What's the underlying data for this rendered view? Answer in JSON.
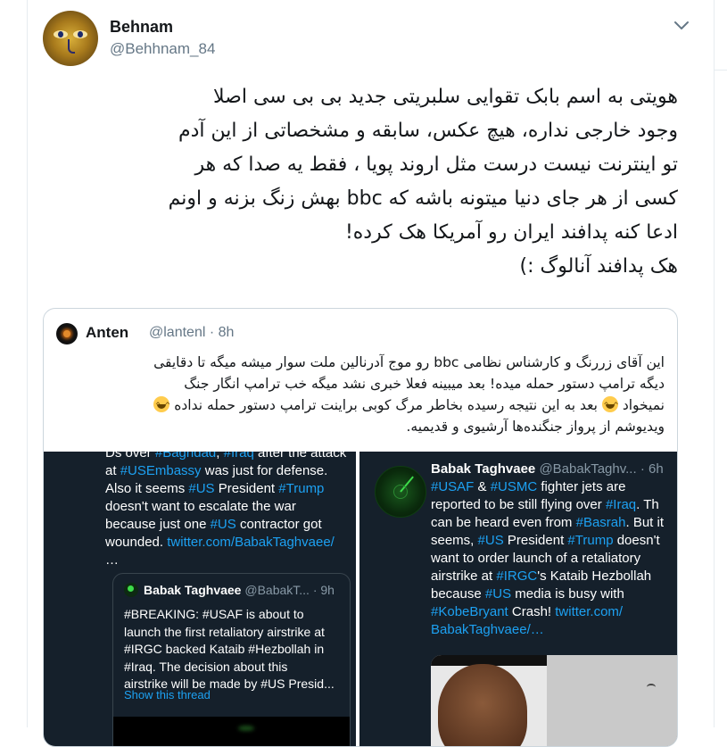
{
  "tweet": {
    "display_name": "Behnam",
    "handle": "@Behhnam_84",
    "text_lines": [
      "هویتی به اسم بابک تقوایی سلبریتی جدید بی بی سی اصلا",
      "وجود خارجی نداره، هیچ عکس، سابقه و مشخصاتی از این آدم",
      "تو اینترنت نیست درست مثل اروند پویا ، فقط یه صدا که هر",
      "کسی از هر جای دنیا میتونه باشه که bbc بهش زنگ بزنه و اونم",
      "ادعا کنه پدافند ایران رو آمریکا هک کرده!",
      "هک پدافند آنالوگ :)"
    ]
  },
  "quoted": {
    "display_name": "Anten",
    "handle": "@lantenl",
    "time": "8h",
    "text_lines": [
      "این آقای زررنگ و کارشناس نظامی bbc رو موج آدرنالین ملت سوار میشه میگه تا دقایقی",
      "دیگه ترامپ دستور حمله میده! بعد میبینه فعلا خبری نشد میگه خب ترامپ انگار جنگ",
      "نمیخواد 😆 بعد به این نتیجه رسیده بخاطر مرگ کوبی براینت ترامپ دستور حمله نداده 😆",
      "ویدیوشم از پرواز جنگنده‌ها آرشیوی و قدیمیه."
    ],
    "text_line3_parts": {
      "before_emoji": "نمیخواد",
      "middle": "بعد به این نتیجه رسیده بخاطر مرگ کوبی براینت ترامپ دستور حمله نداده"
    }
  },
  "media_left": {
    "tweet_lines": [
      [
        "Ds over ",
        "#Baghdad",
        ", ",
        "#Iraq",
        " after the attack"
      ],
      [
        "at ",
        "#USEmbassy",
        " was just for defense."
      ],
      [
        "Also it seems ",
        "#US",
        " President ",
        "#Trump"
      ],
      [
        "doesn't want to escalate the war"
      ],
      [
        "because just one ",
        "#US",
        " contractor got"
      ],
      [
        "wounded. ",
        "twitter.com/BabakTaghvaee/"
      ],
      [
        "…"
      ]
    ],
    "inner": {
      "display_name": "Babak Taghvaee",
      "handle": "@BabakT...",
      "time": "9h",
      "text_lines": [
        "#BREAKING: #USAF is about to",
        "launch the first retaliatory airstrike at",
        "#IRGC backed Kataib #Hezbollah in",
        "#Iraq. The decision about this",
        "airstrike will be made by #US Presid..."
      ],
      "show_thread": "Show this thread"
    }
  },
  "media_right": {
    "display_name": "Babak Taghvaee",
    "handle": "@BabakTaghv...",
    "time": "6h",
    "tweet_lines": [
      [
        "#USAF",
        " & ",
        "#USMC",
        " fighter jets are"
      ],
      [
        "reported to be still flying over ",
        "#Iraq",
        ". Th"
      ],
      [
        "can be heard even from ",
        "#Basrah",
        ". But it"
      ],
      [
        "seems, ",
        "#US",
        " President ",
        "#Trump",
        " doesn't"
      ],
      [
        "want to order launch of a retaliatory"
      ],
      [
        "airstrike at ",
        "#IRGC",
        "'s Kataib Hezbollah"
      ],
      [
        "because ",
        "#US",
        " media is busy with"
      ],
      [
        "#KobeBryant",
        " Crash! ",
        "twitter.com/"
      ],
      [
        "BabakTaghvaee/…"
      ]
    ]
  },
  "colors": {
    "link_blue": "#1da1f2",
    "dark_bg": "#15202b",
    "muted_gray": "#657786",
    "border": "#ccd6dd"
  },
  "icons": [
    "chevron-down-icon",
    "emoji-laughing-icon",
    "radar-avatar-icon"
  ]
}
